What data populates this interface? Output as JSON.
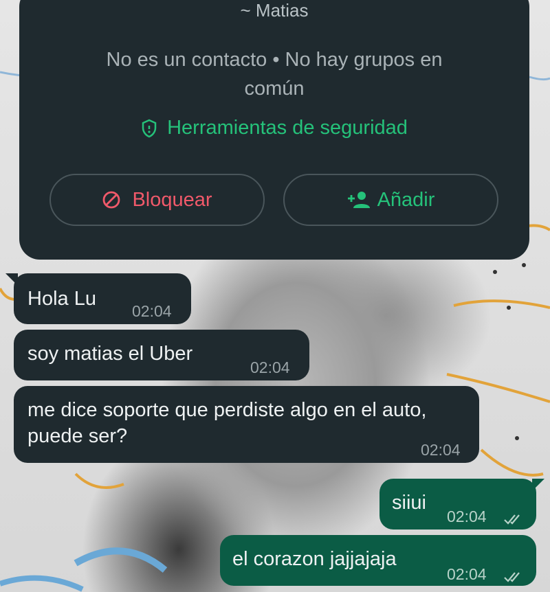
{
  "contact_card": {
    "name": "~ Matias",
    "info": "No es un contacto • No hay grupos en común",
    "security_link": "Herramientas de seguridad",
    "block_label": "Bloquear",
    "add_label": "Añadir"
  },
  "messages": [
    {
      "direction": "in",
      "text": "Hola Lu",
      "time": "02:04"
    },
    {
      "direction": "in",
      "text": "soy matias el Uber",
      "time": "02:04"
    },
    {
      "direction": "in",
      "text": "me dice soporte que perdiste algo en el auto, puede ser?",
      "time": "02:04"
    },
    {
      "direction": "out",
      "text": "siiui",
      "time": "02:04",
      "status": "read"
    },
    {
      "direction": "out",
      "text": "el corazon jajjajaja",
      "time": "02:04",
      "status": "read"
    }
  ],
  "colors": {
    "card_bg": "#1f2a2f",
    "accent_green": "#25c27a",
    "danger_red": "#f0596a",
    "outgoing_bubble": "#0b5c45"
  },
  "icons": {
    "security": "shield-icon",
    "block": "block-icon",
    "add": "add-person-icon",
    "read": "double-check-icon"
  }
}
